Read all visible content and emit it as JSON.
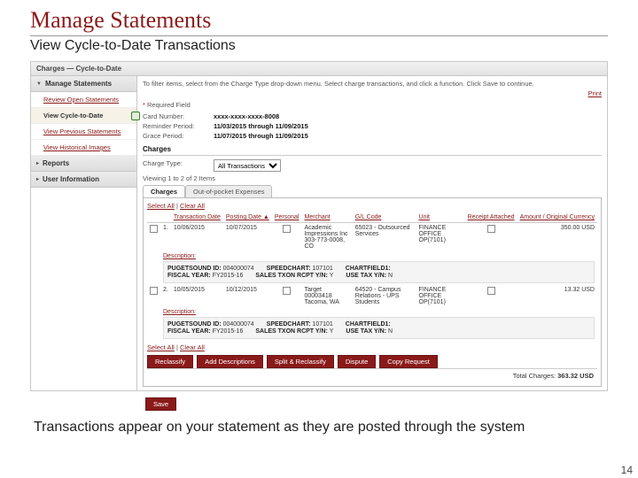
{
  "page": {
    "title": "Manage Statements",
    "subtitle": "View Cycle-to-Date Transactions",
    "caption": "Transactions appear on your statement as they are posted through the system",
    "number": "14"
  },
  "app": {
    "breadcrumb": "Charges — Cycle-to-Date",
    "sidebar": {
      "header": "Manage Statements",
      "items": [
        {
          "label": "Review Open Statements"
        },
        {
          "label": "View Cycle-to-Date",
          "selected": true
        },
        {
          "label": "View Previous Statements"
        },
        {
          "label": "View Historical Images"
        }
      ],
      "sections": [
        {
          "label": "Reports"
        },
        {
          "label": "User Information"
        }
      ]
    },
    "main": {
      "intro": "To filter items, select from the Charge Type drop-down menu. Select charge transactions, and click a function. Click Save to continue.",
      "print": "Print",
      "required": "Required Field",
      "card_label": "Card Number:",
      "card_value": "xxxx-xxxx-xxxx-8008",
      "reminder_label": "Reminder Period:",
      "reminder_value": "11/03/2015 through 11/09/2015",
      "grace_label": "Grace Period:",
      "grace_value": "11/07/2015 through 11/09/2015",
      "charges_heading": "Charges",
      "charge_type_label": "Charge Type:",
      "charge_type_value": "All Transactions",
      "viewing": "Viewing 1 to 2 of 2 Items",
      "tabs": {
        "charges": "Charges",
        "oop": "Out-of-pocket Expenses"
      },
      "select_all": "Select All",
      "clear_all": "Clear All",
      "columns": {
        "tdate": "Transaction Date",
        "pdate": "Posting Date ▲",
        "personal": "Personal",
        "merchant": "Merchant",
        "gl": "G/L Code",
        "unit": "Unit",
        "receipt": "Receipt Attached",
        "amount": "Amount / Original Currency"
      },
      "rows": [
        {
          "n": "1.",
          "tdate": "10/06/2015",
          "pdate": "10/07/2015",
          "merchant": "Academic Impressions Inc\n303-773-0008, CO",
          "gl": "65023 - Outsourced Services",
          "unit": "FINANCE OFFICE OP(7101)",
          "amount": "350.00 USD",
          "description_link": "Description:",
          "details": {
            "budget_id_label": "PUGETSOUND ID:",
            "budget_id": "004000074",
            "speedchart_label": "SPEEDCHART:",
            "speedchart": "107101",
            "chartfield_label": "CHARTFIELD1:",
            "chartfield": "",
            "fy_label": "FISCAL YEAR:",
            "fy": "FY2015-16",
            "stx_label": "SALES TXON RCPT Y/N:",
            "stx": "Y",
            "ut_label": "USE TAX Y/N:",
            "ut": "N"
          }
        },
        {
          "n": "2.",
          "tdate": "10/05/2015",
          "pdate": "10/12/2015",
          "merchant": "Target 00003418\nTacoma, WA",
          "gl": "64520 - Campus Relations - UPS Students",
          "unit": "FINANCE OFFICE OP(7101)",
          "amount": "13.32 USD",
          "description_link": "Description:",
          "details": {
            "budget_id_label": "PUGETSOUND ID:",
            "budget_id": "004000074",
            "speedchart_label": "SPEEDCHART:",
            "speedchart": "107101",
            "chartfield_label": "CHARTFIELD1:",
            "chartfield": "",
            "fy_label": "FISCAL YEAR:",
            "fy": "FY2015-16",
            "stx_label": "SALES TXON RCPT Y/N:",
            "stx": "Y",
            "ut_label": "USE TAX Y/N:",
            "ut": "N"
          }
        }
      ],
      "buttons": {
        "reclassify": "Reclassify",
        "add_desc": "Add Descriptions",
        "split": "Split & Reclassify",
        "dispute": "Dispute",
        "copy": "Copy Request"
      },
      "total_label": "Total Charges:",
      "total_value": "363.32 USD",
      "save": "Save"
    }
  }
}
